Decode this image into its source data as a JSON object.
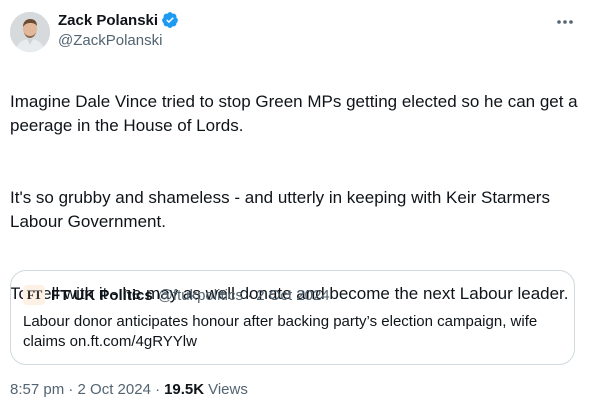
{
  "author": {
    "display_name": "Zack Polanski",
    "handle": "@ZackPolanski",
    "verified_icon": "verified-badge-icon",
    "avatar": "avatar"
  },
  "more_icon": "more-options-icon",
  "tweet": {
    "paragraphs": [
      "Imagine Dale Vince tried to stop Green MPs getting elected so he can get a peerage in the House of Lords.",
      "It's so grubby and shameless - and utterly in keeping with Keir Starmers Labour Government.",
      "To hell with it - he may as well donate and become the next Labour leader."
    ]
  },
  "quote": {
    "avatar_text": "FT",
    "name": "FT UK Politics",
    "meta": "@ftukpolitics · 2 Oct 2024",
    "text": "Labour donor anticipates honour after backing party’s election campaign, wife claims on.ft.com/4gRYYlw"
  },
  "footer": {
    "time": "8:57 pm · 2 Oct 2024 ·",
    "views_count": "19.5K",
    "views_label": "Views"
  },
  "colors": {
    "text": "#0f1419",
    "secondary": "#536471",
    "verified": "#1d9bf0",
    "border": "#cfd9de"
  }
}
